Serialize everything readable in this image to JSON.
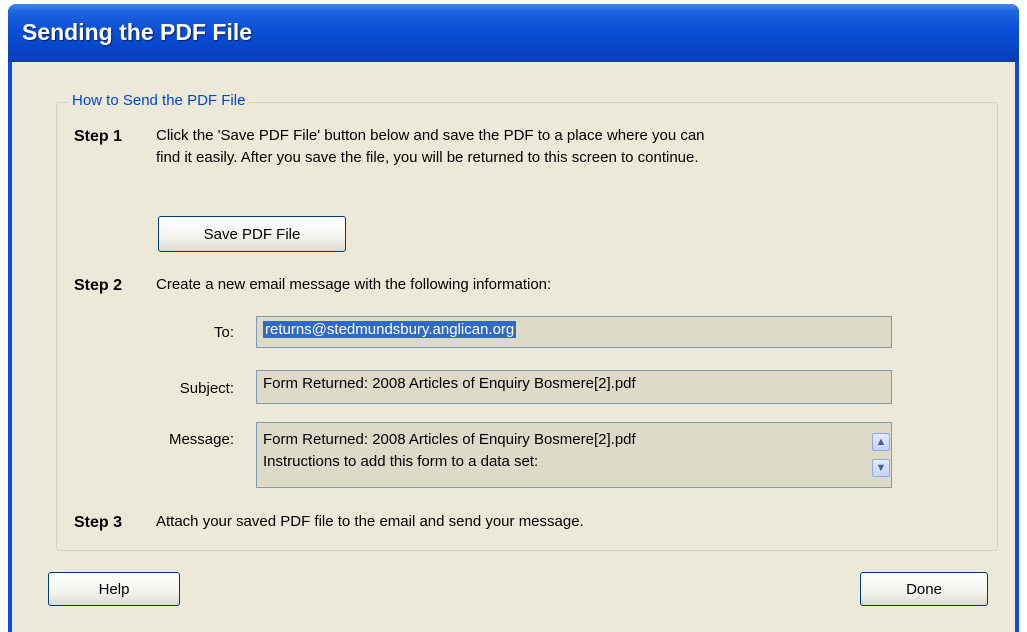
{
  "window": {
    "title": "Sending the PDF File"
  },
  "group": {
    "legend": "How to Send the PDF File"
  },
  "step1": {
    "label": "Step 1",
    "line1": "Click the 'Save PDF File' button below and save the PDF to a place where you can",
    "line2": "find it easily. After you save the file, you will be returned to this screen to continue.",
    "button": "Save PDF File"
  },
  "step2": {
    "label": "Step 2",
    "text": "Create a new email message with the following information:",
    "to_label": "To:",
    "to_value": "returns@stedmundsbury.anglican.org",
    "subject_label": "Subject:",
    "subject_value": "Form Returned: 2008 Articles of Enquiry Bosmere[2].pdf",
    "message_label": "Message:",
    "message_line1": "Form Returned: 2008 Articles of Enquiry Bosmere[2].pdf",
    "message_line2": "Instructions to add this form to a data set:"
  },
  "step3": {
    "label": "Step 3",
    "text": "Attach your saved PDF file to the email and send your message."
  },
  "buttons": {
    "help": "Help",
    "done": "Done"
  },
  "colors": {
    "title_bar": "#0a4fd6",
    "dialog_bg": "#ece9d8",
    "legend_text": "#0046d5",
    "selection": "#316ac5"
  }
}
